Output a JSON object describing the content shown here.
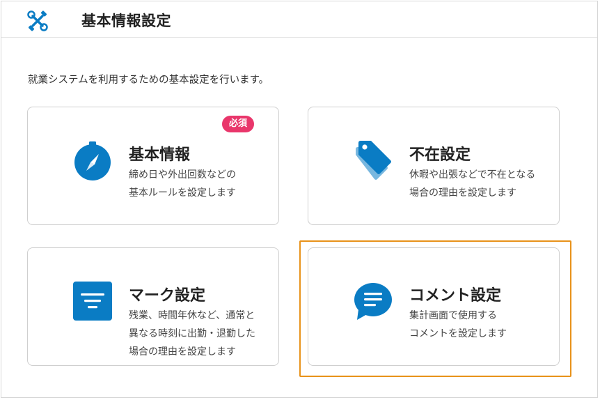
{
  "header": {
    "title": "基本情報設定",
    "icon": "tools-icon"
  },
  "intro": "就業システムを利用するための基本設定を行います。",
  "cards": [
    {
      "title": "基本情報",
      "badge": "必須",
      "desc_lines": [
        "締め日や外出回数などの",
        "基本ルールを設定します"
      ],
      "icon": "compass-icon"
    },
    {
      "title": "不在設定",
      "desc_lines": [
        "休暇や出張などで不在となる",
        "場合の理由を設定します"
      ],
      "icon": "tags-icon"
    },
    {
      "title": "マーク設定",
      "desc_lines": [
        "残業、時間年休など、通常と",
        "異なる時刻に出勤・退勤した",
        "場合の理由を設定します"
      ],
      "icon": "filter-icon"
    },
    {
      "title": "コメント設定",
      "desc_lines": [
        "集計画面で使用する",
        "コメントを設定します"
      ],
      "icon": "comment-icon"
    }
  ],
  "colors": {
    "accent": "#0a7cc4",
    "badge": "#e9366b",
    "highlight": "#e8921a"
  }
}
